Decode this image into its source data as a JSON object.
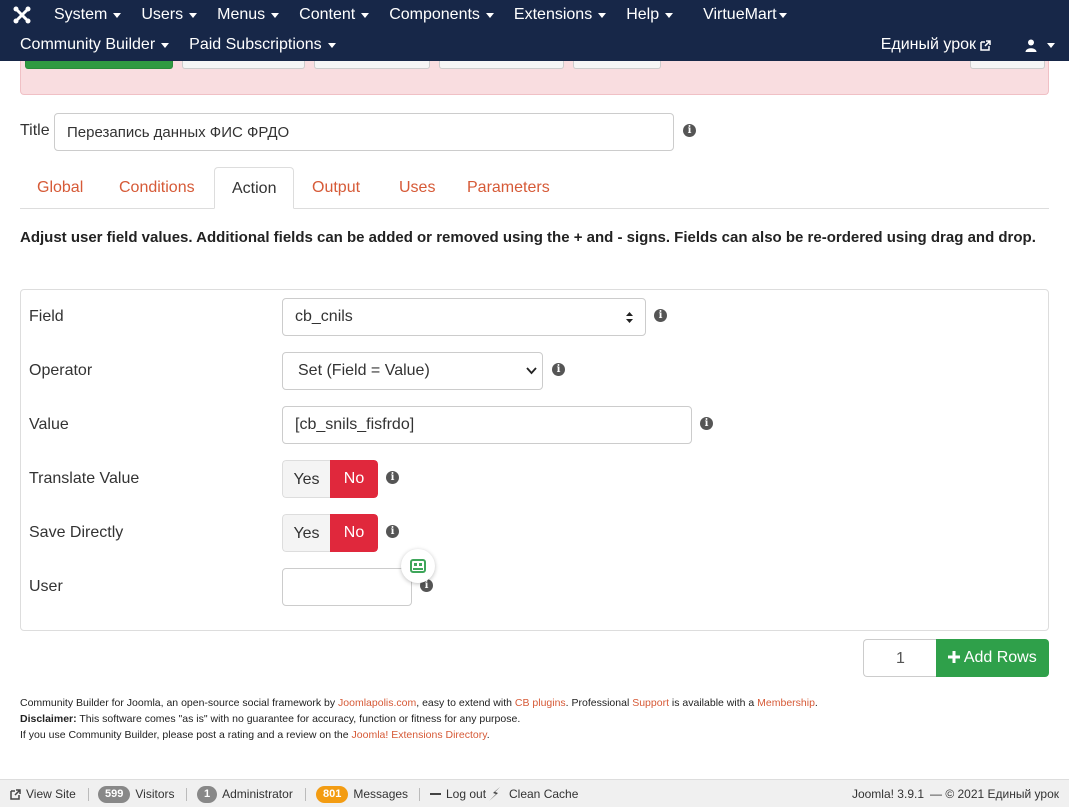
{
  "navbar": {
    "row1": [
      {
        "label": "System",
        "caret": true
      },
      {
        "label": "Users",
        "caret": true
      },
      {
        "label": "Menus",
        "caret": true
      },
      {
        "label": "Content",
        "caret": true
      },
      {
        "label": "Components",
        "caret": true
      },
      {
        "label": "Extensions",
        "caret": true
      },
      {
        "label": "Help",
        "caret": true
      },
      {
        "label": "VirtueMart",
        "caret": true
      }
    ],
    "row2": [
      {
        "label": "Community Builder",
        "caret": true
      },
      {
        "label": "Paid Subscriptions",
        "caret": true
      }
    ],
    "site_link": "Единый урок",
    "bg_color": "#172748"
  },
  "form": {
    "title_label": "Title",
    "title_value": "Перезапись данных ФИС ФРДО"
  },
  "tabs": [
    "Global",
    "Conditions",
    "Action",
    "Output",
    "Uses",
    "Parameters"
  ],
  "active_tab": "Action",
  "description": "Adjust user field values. Additional fields can be added or removed using the + and - signs. Fields can also be re-ordered using drag and drop.",
  "fields": {
    "field_label": "Field",
    "field_value": "cb_cnils",
    "operator_label": "Operator",
    "operator_value": "Set (Field = Value)",
    "value_label": "Value",
    "value_value": "[cb_snils_fisfrdo]",
    "translate_label": "Translate Value",
    "save_label": "Save Directly",
    "user_label": "User",
    "user_value": "",
    "yes": "Yes",
    "no": "No"
  },
  "add_rows": {
    "count": "1",
    "label": "Add Rows",
    "color": "#2fa04a"
  },
  "footer": {
    "line1_a": "Community Builder for Joomla, an open-source social framework by ",
    "line1_link1": "Joomlapolis.com",
    "line1_b": ", easy to extend with ",
    "line1_link2": "CB plugins",
    "line1_c": ". Professional ",
    "line1_link3": "Support",
    "line1_d": " is available with a ",
    "line1_link4": "Membership",
    "line1_e": ".",
    "disclaimer_label": "Disclaimer:",
    "disclaimer_text": " This software comes \"as is\" with no guarantee for accuracy, function or fitness for any purpose.",
    "line3_a": "If you use Community Builder, please post a rating and a review on the ",
    "line3_link": "Joomla! Extensions Directory",
    "line3_b": "."
  },
  "statusbar": {
    "view_site": "View Site",
    "visitors_count": "599",
    "visitors": "Visitors",
    "admin_count": "1",
    "admin": "Administrator",
    "messages_count": "801",
    "messages": "Messages",
    "logout": "Log out",
    "clean_cache": "Clean Cache",
    "version": "Joomla! 3.9.1",
    "copyright": "— © 2021 Единый урок"
  },
  "accent_color": "#d65a37",
  "no_color": "#e0283c"
}
